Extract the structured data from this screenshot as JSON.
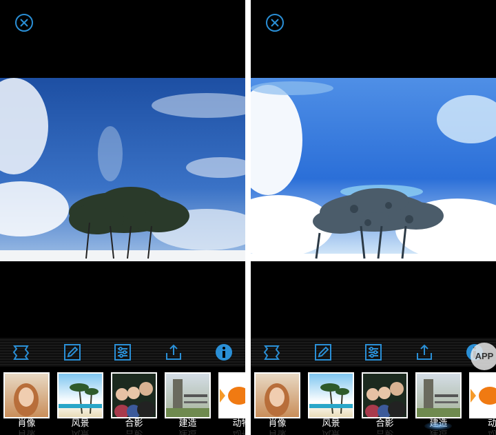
{
  "colors": {
    "accent": "#2a8fd6",
    "background": "#000000",
    "label": "#ffffff"
  },
  "toolbar_icons": [
    "frame-icon",
    "edit-pencil-icon",
    "adjust-sliders-icon",
    "share-upload-icon",
    "info-icon"
  ],
  "left_panel": {
    "close_icon": "close-icon",
    "filters": [
      {
        "label": "肖像",
        "reflection": "肖像",
        "icon": "portrait-thumbnail"
      },
      {
        "label": "风景",
        "reflection": "风景",
        "icon": "landscape-thumbnail"
      },
      {
        "label": "合影",
        "reflection": "合影",
        "icon": "group-photo-thumbnail"
      },
      {
        "label": "建造",
        "reflection": "建造",
        "icon": "building-thumbnail"
      },
      {
        "label": "动物",
        "reflection": "动物",
        "icon": "animal-thumbnail"
      }
    ]
  },
  "right_panel": {
    "close_icon": "close-icon",
    "selected_filter": "建造",
    "filters": [
      {
        "label": "肖像",
        "reflection": "肖像",
        "icon": "portrait-thumbnail"
      },
      {
        "label": "风景",
        "reflection": "风景",
        "icon": "landscape-thumbnail"
      },
      {
        "label": "合影",
        "reflection": "合影",
        "icon": "group-photo-thumbnail"
      },
      {
        "label": "建造",
        "reflection": "建造",
        "icon": "building-thumbnail"
      },
      {
        "label": "动",
        "reflection": "动",
        "icon": "animal-thumbnail"
      }
    ]
  },
  "watermark": "APP"
}
